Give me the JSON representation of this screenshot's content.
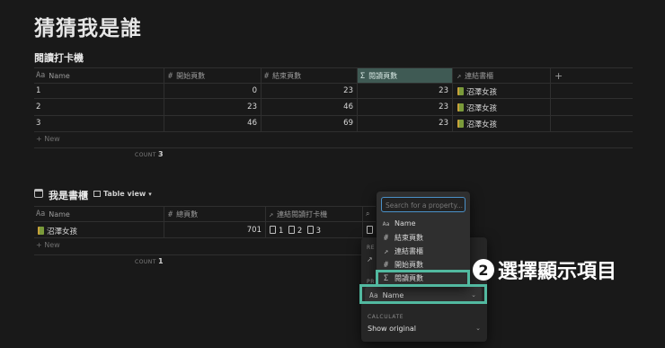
{
  "page_title": "猜猜我是誰",
  "db1": {
    "title": "閱讀打卡機",
    "columns": [
      {
        "icon": "Aa",
        "label": "Name"
      },
      {
        "icon": "#",
        "label": "開始頁數"
      },
      {
        "icon": "#",
        "label": "結束頁數"
      },
      {
        "icon": "Σ",
        "label": "閱讀頁數"
      },
      {
        "icon": "↗",
        "label": "連結書櫃"
      }
    ],
    "add_col": "+",
    "rows": [
      {
        "name": "1",
        "start": "0",
        "end": "23",
        "read": "23",
        "book": "沼澤女孩"
      },
      {
        "name": "2",
        "start": "23",
        "end": "46",
        "read": "23",
        "book": "沼澤女孩"
      },
      {
        "name": "3",
        "start": "46",
        "end": "69",
        "read": "23",
        "book": "沼澤女孩"
      }
    ],
    "new_label": "+ New",
    "count_label": "COUNT",
    "count_value": "3"
  },
  "db2": {
    "title": "我是書櫃",
    "view_label": "Table view",
    "columns": [
      {
        "icon": "Aa",
        "label": "Name"
      },
      {
        "icon": "#",
        "label": "總頁數"
      },
      {
        "icon": "↗",
        "label": "連結閱讀打卡機"
      }
    ],
    "row": {
      "name": "沼澤女孩",
      "total": "701",
      "links": [
        "1",
        "2",
        "3"
      ]
    },
    "new_label": "+ New",
    "count_label": "COUNT",
    "count_value": "1"
  },
  "property_menu": {
    "search_placeholder": "Search for a property...",
    "items": [
      {
        "icon": "Aa",
        "label": "Name"
      },
      {
        "icon": "#",
        "label": "結束頁數"
      },
      {
        "icon": "↗",
        "label": "連結書櫃"
      },
      {
        "icon": "#",
        "label": "開始頁數"
      },
      {
        "icon": "Σ",
        "label": "閱讀頁數"
      }
    ]
  },
  "rollup_panel": {
    "property_value": "Name",
    "calculate_label": "CALCULATE",
    "calculate_value": "Show original"
  },
  "annotation": {
    "number": "2",
    "text": "選擇顯示項目"
  },
  "colors": {
    "background": "#191919",
    "highlight_column": "#3f5a54",
    "annotation_box": "#52b9a0"
  }
}
